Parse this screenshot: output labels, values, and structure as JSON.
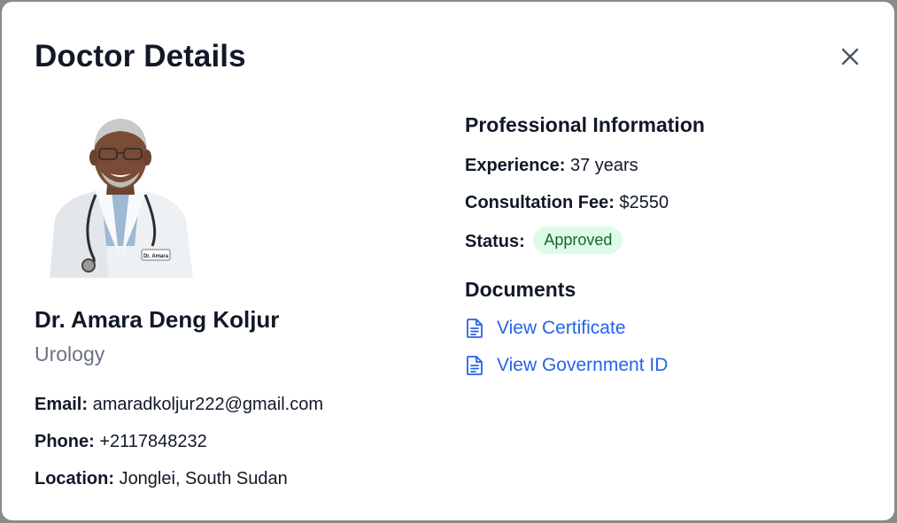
{
  "modal": {
    "title": "Doctor Details",
    "close_icon": "close-icon"
  },
  "doctor": {
    "photo_icon": "doctor-photo",
    "name": "Dr. Amara Deng Koljur",
    "specialty": "Urology",
    "email_label": "Email:",
    "email": "amaradkoljur222@gmail.com",
    "phone_label": "Phone:",
    "phone": "+2117848232",
    "location_label": "Location:",
    "location": "Jonglei, South Sudan",
    "badge_text": "Dr. Amara"
  },
  "professional": {
    "title": "Professional Information",
    "experience_label": "Experience:",
    "experience": "37 years",
    "fee_label": "Consultation Fee:",
    "fee": "$2550",
    "status_label": "Status:",
    "status": "Approved",
    "status_color": "#dcfce7"
  },
  "documents": {
    "title": "Documents",
    "items": [
      {
        "label": "View Certificate",
        "icon": "document-icon"
      },
      {
        "label": "View Government ID",
        "icon": "document-icon"
      }
    ],
    "link_color": "#2563eb"
  }
}
